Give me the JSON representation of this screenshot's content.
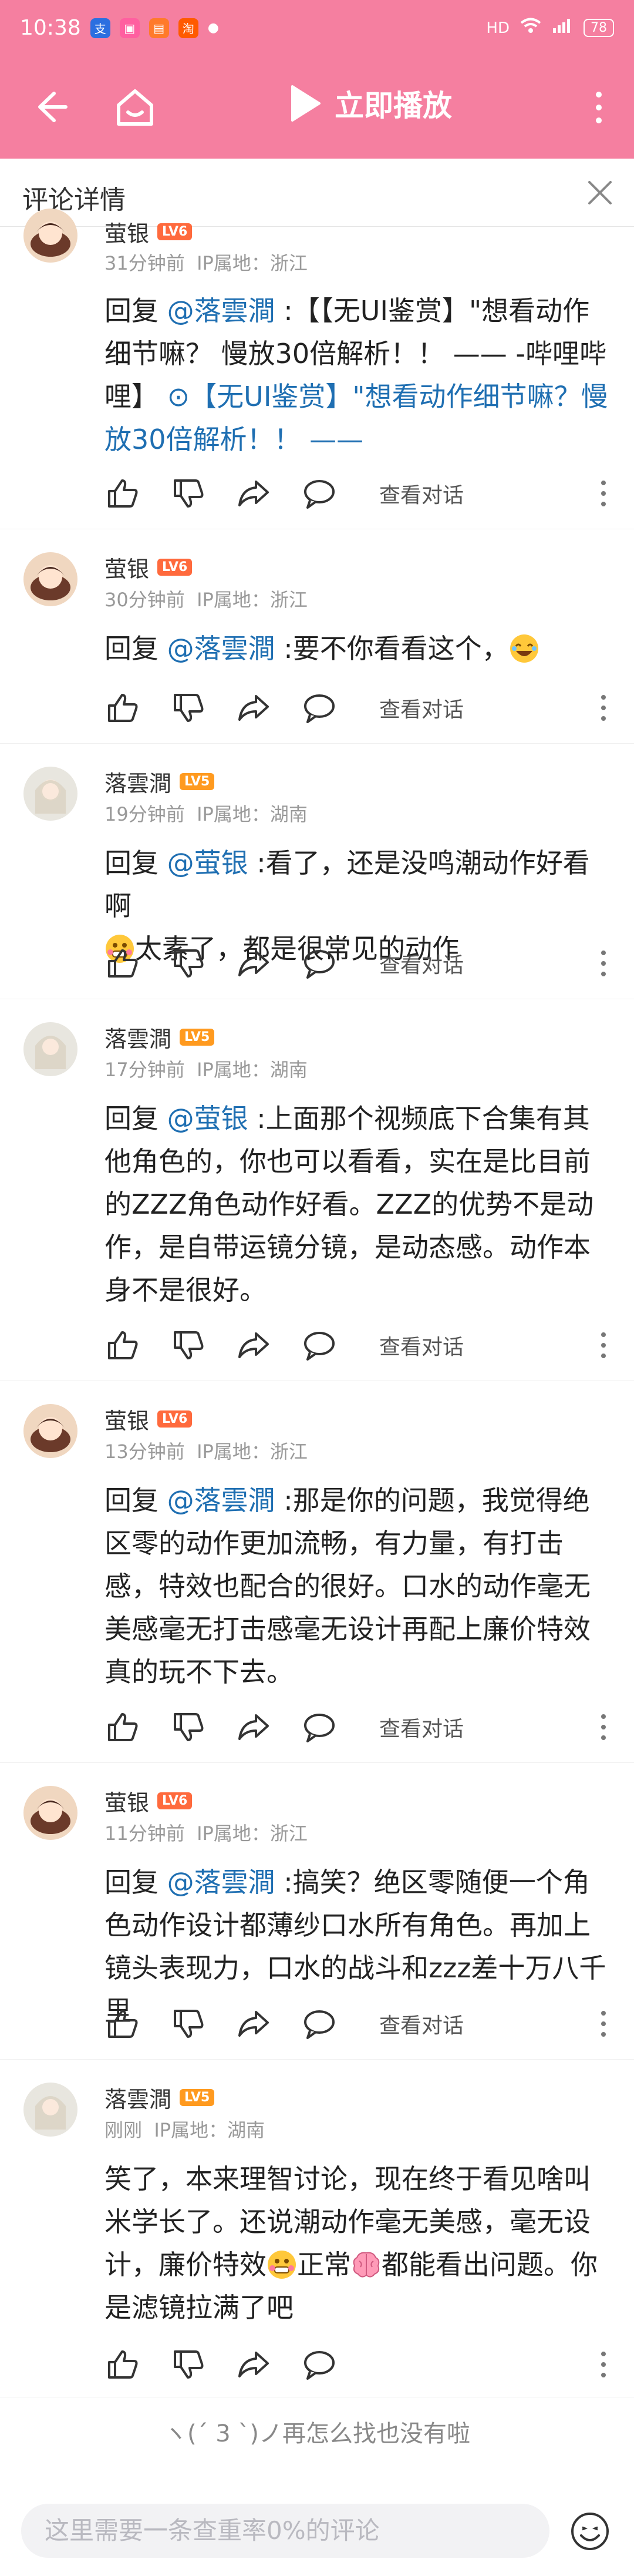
{
  "status": {
    "time": "10:38",
    "battery": "78"
  },
  "nav": {
    "play_label": "立即播放"
  },
  "sheet": {
    "title": "评论详情"
  },
  "comments": [
    {
      "name": "萤银",
      "level": "LV6",
      "time": "31分钟前",
      "ip": "IP属地：浙江",
      "reply_prefix": "回复 ",
      "mention": "@落雲澗",
      "text1": " :【【无UI鉴赏】\"想看动作细节嘛？ 慢放30倍解析！！ —— -哔哩哔哩】 ",
      "link": "【无UI鉴赏】\"想看动作细节嘛？慢放30倍解析！！ ——",
      "convo": "查看对话"
    },
    {
      "name": "萤银",
      "level": "LV6",
      "time": "30分钟前",
      "ip": "IP属地：浙江",
      "reply_prefix": "回复 ",
      "mention": "@落雲澗",
      "text1": " :要不你看看这个，",
      "convo": "查看对话"
    },
    {
      "name": "落雲澗",
      "level": "LV5",
      "time": "19分钟前",
      "ip": "IP属地：湖南",
      "reply_prefix": "回复 ",
      "mention": "@萤银",
      "text1": " :看了，还是没鸣潮动作好看啊",
      "text2": "太素了，都是很常见的动作",
      "convo": "查看对话"
    },
    {
      "name": "落雲澗",
      "level": "LV5",
      "time": "17分钟前",
      "ip": "IP属地：湖南",
      "reply_prefix": "回复 ",
      "mention": "@萤银",
      "text1": " :上面那个视频底下合集有其他角色的，你也可以看看，实在是比目前的ZZZ角色动作好看。ZZZ的优势不是动作，是自带运镜分镜，是动态感。动作本身不是很好。",
      "convo": "查看对话"
    },
    {
      "name": "萤银",
      "level": "LV6",
      "time": "13分钟前",
      "ip": "IP属地：浙江",
      "reply_prefix": "回复 ",
      "mention": "@落雲澗",
      "text1": " :那是你的问题，我觉得绝区零的动作更加流畅，有力量，有打击感，特效也配合的很好。口水的动作毫无美感毫无打击感毫无设计再配上廉价特效真的玩不下去。",
      "convo": "查看对话"
    },
    {
      "name": "萤银",
      "level": "LV6",
      "time": "11分钟前",
      "ip": "IP属地：浙江",
      "reply_prefix": "回复 ",
      "mention": "@落雲澗",
      "text1": " :搞笑？绝区零随便一个角色动作设计都薄纱口水所有角色。再加上镜头表现力，口水的战斗和zzz差十万八千里",
      "convo": "查看对话"
    },
    {
      "name": "落雲澗",
      "level": "LV5",
      "time": "刚刚",
      "ip": "IP属地：湖南",
      "text1": "笑了，本来理智讨论，现在终于看见啥叫米学长了。还说潮动作毫无美感，毫无设计，廉价特效",
      "text2": "正常",
      "text3": "都能看出问题。你是滤镜拉满了吧"
    }
  ],
  "footer": {
    "end_text": "ヽ(ˊ 3 ˋ)ノ再怎么找也没有啦",
    "input_placeholder": "这里需要一条查重率0%的评论"
  }
}
